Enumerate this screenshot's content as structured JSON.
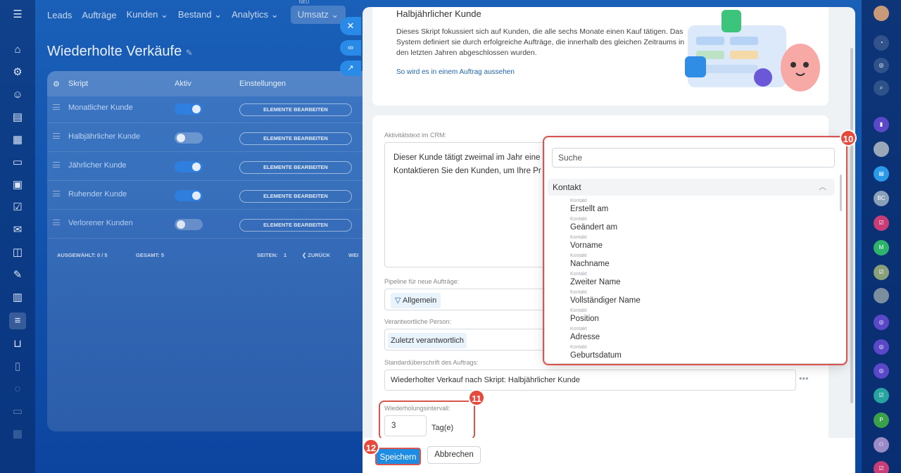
{
  "nav": {
    "items": [
      "Leads",
      "Aufträge",
      "Kunden",
      "Bestand",
      "Analytics"
    ],
    "active": "Umsatz",
    "active_tag": "NEU"
  },
  "page": {
    "title": "Wiederholte Verkäufe"
  },
  "table": {
    "headers": {
      "script": "Skript",
      "active": "Aktiv",
      "settings": "Einstellungen"
    },
    "rows": [
      {
        "name": "Monatlicher Kunde",
        "active": true,
        "toggle": "EIN",
        "button": "ELEMENTE BEARBEITEN"
      },
      {
        "name": "Halbjährlicher Kunde",
        "active": false,
        "toggle": "AUS",
        "button": "ELEMENTE BEARBEITEN"
      },
      {
        "name": "Jährlicher Kunde",
        "active": true,
        "toggle": "EIN",
        "button": "ELEMENTE BEARBEITEN"
      },
      {
        "name": "Ruhender Kunde",
        "active": true,
        "toggle": "EIN",
        "button": "ELEMENTE BEARBEITEN"
      },
      {
        "name": "Verlorener Kunden",
        "active": false,
        "toggle": "AUS",
        "button": "ELEMENTE BEARBEITEN"
      }
    ],
    "footer": {
      "selected": "AUSGEWÄHLT: 0 / 5",
      "total": "GESAMT: 5",
      "pages": "SEITEN:",
      "page_num": "1",
      "back": "❮ ZURÜCK",
      "next": "WEI"
    }
  },
  "slider": {
    "title": "Halbjährlicher Kunde",
    "description": "Dieses Skript fokussiert sich auf Kunden, die alle sechs Monate einen Kauf tätigen. Das System definiert sie durch erfolgreiche Aufträge, die innerhalb des gleichen Zeitraums in den letzten Jahren abgeschlossen wurden.",
    "link": "So wird es in einem Auftrag aussehen",
    "crm_label": "Aktivitätstext im CRM:",
    "crm_line1": "Dieser Kunde tätigt zweimal im Jahr eine",
    "crm_line2": "Kontaktieren Sie den Kunden, um Ihre Pr",
    "pipeline_label": "Pipeline für neue Aufträge:",
    "pipeline_value": "Allgemein",
    "person_label": "Verantwortliche Person:",
    "person_value": "Zuletzt verantwortlich",
    "heading_label": "Standardüberschrift des Auftrags:",
    "heading_value": "Wiederholter Verkauf nach Skript: Halbjährlicher Kunde",
    "interval_label": "Wiederholungsintervall:",
    "interval_value": "3",
    "interval_unit": "Tag(e)",
    "save": "Speichern",
    "cancel": "Abbrechen"
  },
  "dropdown": {
    "search_placeholder": "Suche",
    "section": "Kontakt",
    "items": [
      {
        "group": "Kontakt",
        "label": "Erstellt am"
      },
      {
        "group": "Kontakt",
        "label": "Geändert am"
      },
      {
        "group": "Kontakt",
        "label": "Vorname"
      },
      {
        "group": "Kontakt",
        "label": "Nachname"
      },
      {
        "group": "Kontakt",
        "label": "Zweiter Name"
      },
      {
        "group": "Kontakt",
        "label": "Vollständiger Name"
      },
      {
        "group": "Kontakt",
        "label": "Position"
      },
      {
        "group": "Kontakt",
        "label": "Adresse"
      },
      {
        "group": "Kontakt",
        "label": "Geburtsdatum"
      }
    ]
  },
  "badges": {
    "b10": "10",
    "b11": "11",
    "b12": "12"
  },
  "right_sidebar": {
    "avatars": [
      "BC",
      "M",
      "P"
    ]
  },
  "colors": {
    "accent": "#1f8ce3",
    "highlight": "#d9534f",
    "badge": "#e64a3c"
  }
}
